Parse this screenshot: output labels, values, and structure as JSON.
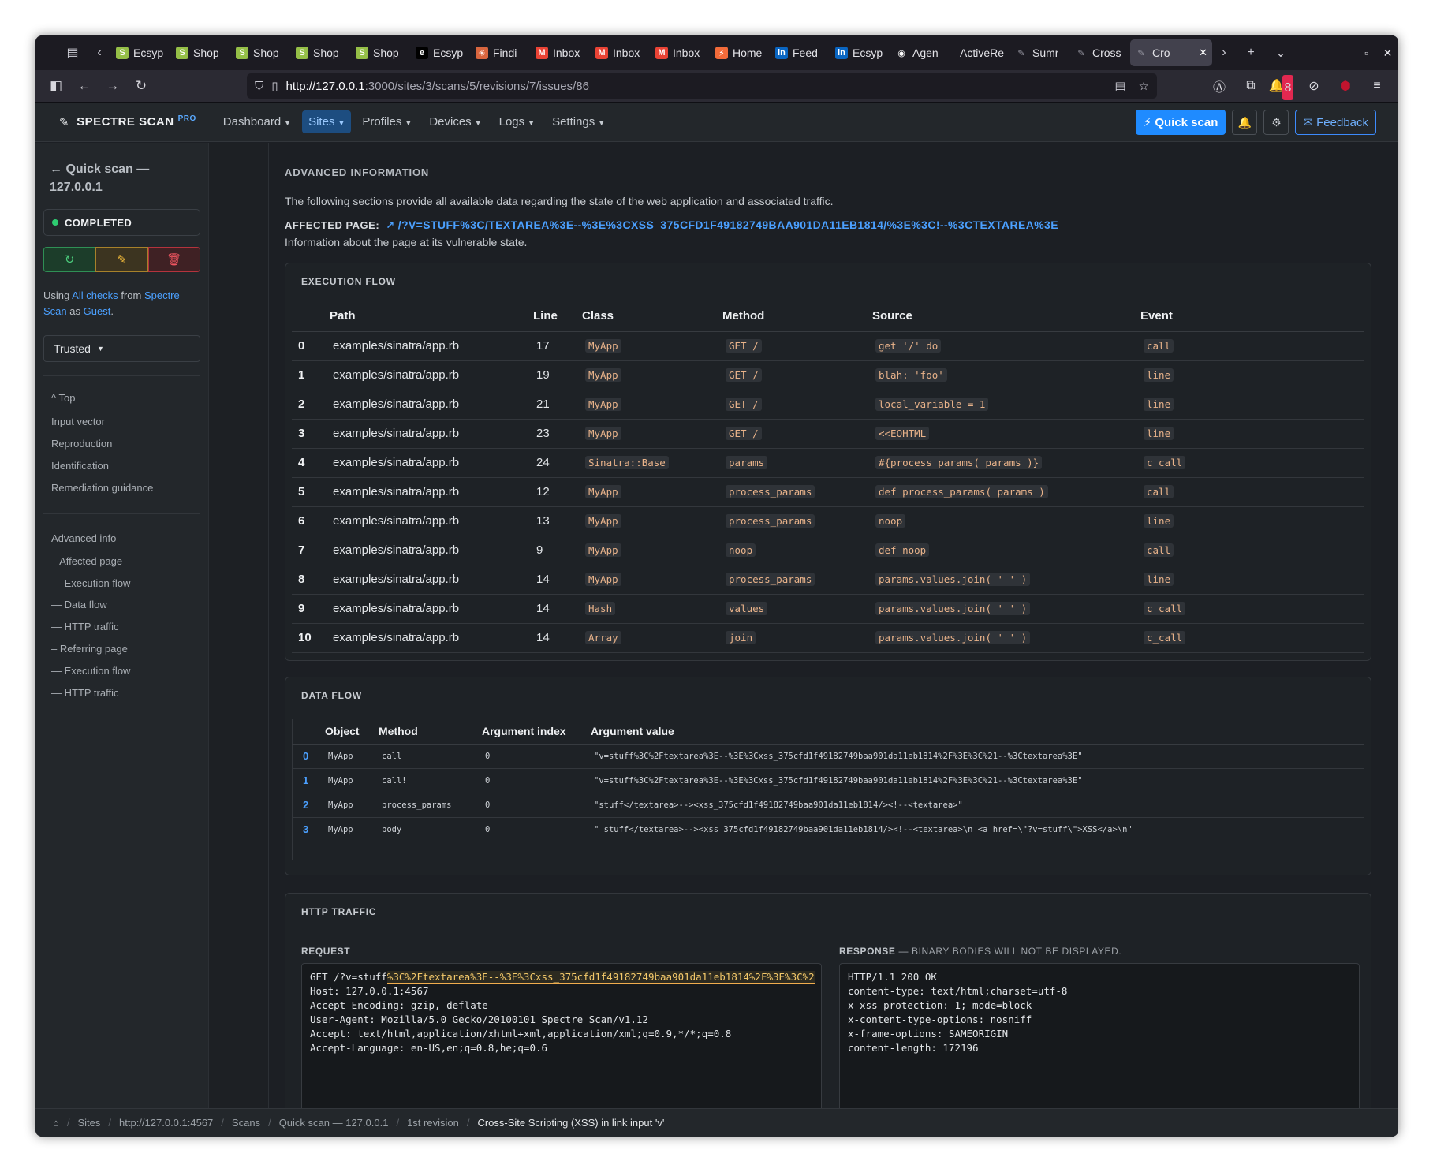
{
  "browser": {
    "tabs": [
      {
        "label": "Ecsyp",
        "icon": "shopify-icon",
        "color": "#95bf47"
      },
      {
        "label": "Shop",
        "icon": "shopify-icon",
        "color": "#95bf47"
      },
      {
        "label": "Shop",
        "icon": "shopify-icon",
        "color": "#95bf47"
      },
      {
        "label": "Shop",
        "icon": "shopify-icon",
        "color": "#95bf47"
      },
      {
        "label": "Shop",
        "icon": "shopify-icon",
        "color": "#95bf47"
      },
      {
        "label": "Ecsyp",
        "icon": "e-icon",
        "color": "#000000"
      },
      {
        "label": "Findi",
        "icon": "asterisk-icon",
        "color": "#d9663f"
      },
      {
        "label": "Inbox",
        "icon": "gmail-icon",
        "color": "#ea4335"
      },
      {
        "label": "Inbox",
        "icon": "gmail-icon",
        "color": "#ea4335"
      },
      {
        "label": "Inbox",
        "icon": "gmail-icon",
        "color": "#ea4335"
      },
      {
        "label": "Home",
        "icon": "bolt-icon",
        "color": "#f26b3a"
      },
      {
        "label": "Feed",
        "icon": "linkedin-icon",
        "color": "#0a66c2"
      },
      {
        "label": "Ecsyp",
        "icon": "linkedin-icon",
        "color": "#0a66c2"
      },
      {
        "label": "Agen",
        "icon": "github-icon",
        "color": "#ffffff"
      },
      {
        "label": "ActiveRe",
        "icon": "none",
        "color": "#1c1b22"
      },
      {
        "label": "Sumr",
        "icon": "pencil-icon",
        "color": "#9a9aa5"
      },
      {
        "label": "Cross",
        "icon": "pencil-icon",
        "color": "#9a9aa5"
      },
      {
        "label": "Cro",
        "icon": "pencil-icon",
        "color": "#9a9aa5",
        "active": true
      }
    ],
    "url_host": "http://127.0.0.1",
    "url_rest": ":3000/sites/3/scans/5/revisions/7/issues/86",
    "ext_badge": "8"
  },
  "app": {
    "brand": "SPECTRE SCAN",
    "brand_pro": "PRO",
    "menu": [
      {
        "label": "Dashboard",
        "active": false
      },
      {
        "label": "Sites",
        "active": true
      },
      {
        "label": "Profiles",
        "active": false
      },
      {
        "label": "Devices",
        "active": false
      },
      {
        "label": "Logs",
        "active": false
      },
      {
        "label": "Settings",
        "active": false
      }
    ],
    "quick_scan": "Quick scan",
    "feedback": "Feedback"
  },
  "sidebar": {
    "title_line1": "Quick scan —",
    "title_line2": "127.0.0.1",
    "status": "COMPLETED",
    "using_prefix": "Using",
    "using_checks": "All checks",
    "using_from": "from",
    "using_spectre": "Spectre",
    "using_scan": "Scan",
    "using_as": "as",
    "using_guest": "Guest",
    "trusted": "Trusted",
    "nav1": [
      "Top",
      "Input vector",
      "Reproduction",
      "Identification",
      "Remediation guidance"
    ],
    "nav2": [
      "Advanced info",
      "– Affected page",
      "— Execution flow",
      "— Data flow",
      "— HTTP traffic",
      "– Referring page",
      "— Execution flow",
      "— HTTP traffic"
    ]
  },
  "main": {
    "section_title": "ADVANCED INFORMATION",
    "intro": "The following sections provide all available data regarding the state of the web application and associated traffic.",
    "affected_label": "AFFECTED PAGE:",
    "affected_value": "/?V=STUFF%3C/TEXTAREA%3E--%3E%3CXSS_375CFD1F49182749BAA901DA11EB1814/%3E%3C!--%3CTEXTAREA%3E",
    "affected_desc": "Information about the page at its vulnerable state."
  },
  "execution_flow": {
    "title": "EXECUTION FLOW",
    "headers": [
      "Path",
      "Line",
      "Class",
      "Method",
      "Source",
      "Event"
    ],
    "rows": [
      {
        "idx": "0",
        "path": "examples/sinatra/app.rb",
        "line": "17",
        "class": "MyApp",
        "method": "GET /",
        "source": "get '/' do",
        "event": "call"
      },
      {
        "idx": "1",
        "path": "examples/sinatra/app.rb",
        "line": "19",
        "class": "MyApp",
        "method": "GET /",
        "source": "blah: 'foo'",
        "event": "line"
      },
      {
        "idx": "2",
        "path": "examples/sinatra/app.rb",
        "line": "21",
        "class": "MyApp",
        "method": "GET /",
        "source": "local_variable = 1",
        "event": "line"
      },
      {
        "idx": "3",
        "path": "examples/sinatra/app.rb",
        "line": "23",
        "class": "MyApp",
        "method": "GET /",
        "source": "<<EOHTML",
        "event": "line"
      },
      {
        "idx": "4",
        "path": "examples/sinatra/app.rb",
        "line": "24",
        "class": "Sinatra::Base",
        "method": "params",
        "source": "#{process_params( params )}",
        "event": "c_call"
      },
      {
        "idx": "5",
        "path": "examples/sinatra/app.rb",
        "line": "12",
        "class": "MyApp",
        "method": "process_params",
        "source": "def process_params( params )",
        "event": "call"
      },
      {
        "idx": "6",
        "path": "examples/sinatra/app.rb",
        "line": "13",
        "class": "MyApp",
        "method": "process_params",
        "source": "noop",
        "event": "line"
      },
      {
        "idx": "7",
        "path": "examples/sinatra/app.rb",
        "line": "9",
        "class": "MyApp",
        "method": "noop",
        "source": "def noop",
        "event": "call"
      },
      {
        "idx": "8",
        "path": "examples/sinatra/app.rb",
        "line": "14",
        "class": "MyApp",
        "method": "process_params",
        "source": "params.values.join( ' ' )",
        "event": "line"
      },
      {
        "idx": "9",
        "path": "examples/sinatra/app.rb",
        "line": "14",
        "class": "Hash",
        "method": "values",
        "source": "params.values.join( ' ' )",
        "event": "c_call"
      },
      {
        "idx": "10",
        "path": "examples/sinatra/app.rb",
        "line": "14",
        "class": "Array",
        "method": "join",
        "source": "params.values.join( ' ' )",
        "event": "c_call"
      }
    ]
  },
  "data_flow": {
    "title": "DATA FLOW",
    "headers": [
      "Object",
      "Method",
      "Argument index",
      "Argument value"
    ],
    "rows": [
      {
        "idx": "0",
        "object": "MyApp",
        "method": "call",
        "arg_index": "0",
        "arg_value": "\"v=stuff%3C%2Ftextarea%3E--%3E%3Cxss_375cfd1f49182749baa901da11eb1814%2F%3E%3C%21--%3Ctextarea%3E\""
      },
      {
        "idx": "1",
        "object": "MyApp",
        "method": "call!",
        "arg_index": "0",
        "arg_value": "\"v=stuff%3C%2Ftextarea%3E--%3E%3Cxss_375cfd1f49182749baa901da11eb1814%2F%3E%3C%21--%3Ctextarea%3E\""
      },
      {
        "idx": "2",
        "object": "MyApp",
        "method": "process_params",
        "arg_index": "0",
        "arg_value": "\"stuff</textarea>--><xss_375cfd1f49182749baa901da11eb1814/><!--<textarea>\""
      },
      {
        "idx": "3",
        "object": "MyApp",
        "method": "body",
        "arg_index": "0",
        "arg_value": "\" stuff</textarea>--><xss_375cfd1f49182749baa901da11eb1814/><!--<textarea>\\n <a href=\\\"?v=stuff\\\">XSS</a>\\n\""
      }
    ]
  },
  "http_traffic": {
    "title": "HTTP TRAFFIC",
    "request_label": "REQUEST",
    "response_label": "RESPONSE",
    "response_note": "— BINARY BODIES WILL NOT BE DISPLAYED.",
    "request_first_prefix": "GET /?v=stuff",
    "request_first_highlight": "%3C%2Ftextarea%3E--%3E%3Cxss_375cfd1f49182749baa901da11eb1814%2F%3E%3C%2",
    "request_lines": [
      "Host: 127.0.0.1:4567",
      "Accept-Encoding: gzip, deflate",
      "User-Agent: Mozilla/5.0 Gecko/20100101 Spectre Scan/v1.12",
      "Accept: text/html,application/xhtml+xml,application/xml;q=0.9,*/*;q=0.8",
      "Accept-Language: en-US,en;q=0.8,he;q=0.6"
    ],
    "response_lines": [
      "HTTP/1.1 200 OK",
      "content-type: text/html;charset=utf-8",
      "x-xss-protection: 1; mode=block",
      "x-content-type-options: nosniff",
      "x-frame-options: SAMEORIGIN",
      "content-length: 172196"
    ]
  },
  "breadcrumb": [
    "Sites",
    "http://127.0.0.1:4567",
    "Scans",
    "Quick scan — 127.0.0.1",
    "1st revision",
    "Cross-Site Scripting (XSS) in link input 'v'"
  ]
}
